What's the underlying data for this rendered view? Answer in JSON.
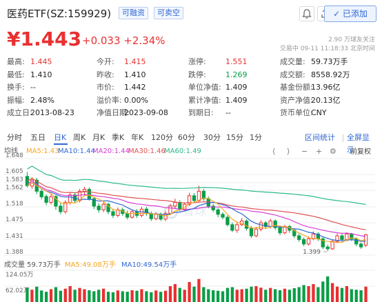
{
  "header": {
    "title": "医药ETF(SZ:159929)",
    "tags": [
      "可融资",
      "可卖空"
    ],
    "watch_label": "✓ 已添加"
  },
  "quote": {
    "price": "¥1.443",
    "change": "+0.033 +2.34%",
    "followers": "2.90 万球友关注",
    "status": "交易中 09-11 11:18:33 北京时间"
  },
  "stats": [
    [
      {
        "l": "最高:",
        "v": "1.445",
        "c": "red"
      },
      {
        "l": "今开:",
        "v": "1.415",
        "c": "red"
      },
      {
        "l": "涨停:",
        "v": "1.551",
        "c": "red"
      },
      {
        "l": "成交量:",
        "v": "59.73万手",
        "c": ""
      }
    ],
    [
      {
        "l": "最低:",
        "v": "1.410",
        "c": ""
      },
      {
        "l": "昨收:",
        "v": "1.410",
        "c": ""
      },
      {
        "l": "跌停:",
        "v": "1.269",
        "c": "green"
      },
      {
        "l": "成交额:",
        "v": "8558.92万",
        "c": ""
      }
    ],
    [
      {
        "l": "换手:",
        "v": "--",
        "c": ""
      },
      {
        "l": "市价:",
        "v": "1.442",
        "c": ""
      },
      {
        "l": "单位净值:",
        "v": "1.409",
        "c": ""
      },
      {
        "l": "基金份额:",
        "v": "13.96亿",
        "c": ""
      }
    ],
    [
      {
        "l": "振幅:",
        "v": "2.48%",
        "c": ""
      },
      {
        "l": "溢价率:",
        "v": "0.00%",
        "c": ""
      },
      {
        "l": "累计净值:",
        "v": "1.409",
        "c": ""
      },
      {
        "l": "资产净值:",
        "v": "20.13亿",
        "c": ""
      }
    ],
    [
      {
        "l": "成立日:",
        "v": "2013-08-23",
        "c": ""
      },
      {
        "l": "净值日期:",
        "v": "2023-09-08",
        "c": ""
      },
      {
        "l": "到期日:",
        "v": "--",
        "c": ""
      },
      {
        "l": "货币单位:",
        "v": "CNY",
        "c": ""
      }
    ]
  ],
  "tabs": [
    "分时",
    "五日",
    "日K",
    "周K",
    "月K",
    "季K",
    "年K",
    "120分",
    "60分",
    "30分",
    "15分",
    "1分"
  ],
  "active_tab": "日K",
  "tab_actions": [
    "区间统计",
    "全屏显示"
  ],
  "kline": {
    "legend": {
      "label": "均线",
      "ma5": "MA5:1.43",
      "ma10": "MA10:1.44",
      "ma20": "MA20:1.44",
      "ma30": "MA30:1.46",
      "ma60": "MA60:1.49"
    },
    "adjust": "前复权",
    "y_ticks": [
      "1.648",
      "1.605",
      "1.583",
      "1.562",
      "1.518",
      "1.475",
      "1.431",
      "1.388"
    ],
    "min_label": "1.399",
    "colors": {
      "up": "#e93030",
      "down": "#0a9e46",
      "ma5": "#f5a623",
      "ma10": "#2f66d4",
      "ma20": "#d63bd6",
      "ma30": "#e05050",
      "ma60": "#2bb98a"
    }
  },
  "volume": {
    "legend": {
      "vol": "成交量 59.73万手",
      "ma5": "MA5:49.08万手",
      "ma10": "MA10:49.54万手"
    },
    "y_ticks": [
      "124.05万",
      "62.02万"
    ]
  },
  "chart_data": {
    "type": "candlestick",
    "ylim": [
      1.388,
      1.648
    ],
    "candles": [
      [
        1.6,
        1.575,
        1.612,
        1.57
      ],
      [
        1.574,
        1.59,
        1.598,
        1.566
      ],
      [
        1.59,
        1.56,
        1.596,
        1.552
      ],
      [
        1.56,
        1.545,
        1.568,
        1.538
      ],
      [
        1.546,
        1.53,
        1.552,
        1.522
      ],
      [
        1.53,
        1.545,
        1.552,
        1.524
      ],
      [
        1.546,
        1.52,
        1.55,
        1.51
      ],
      [
        1.52,
        1.505,
        1.528,
        1.498
      ],
      [
        1.505,
        1.53,
        1.536,
        1.5
      ],
      [
        1.53,
        1.55,
        1.556,
        1.524
      ],
      [
        1.55,
        1.535,
        1.556,
        1.528
      ],
      [
        1.535,
        1.56,
        1.566,
        1.53
      ],
      [
        1.56,
        1.565,
        1.572,
        1.548
      ],
      [
        1.565,
        1.54,
        1.57,
        1.535
      ],
      [
        1.54,
        1.52,
        1.545,
        1.512
      ],
      [
        1.52,
        1.51,
        1.528,
        1.502
      ],
      [
        1.51,
        1.525,
        1.53,
        1.504
      ],
      [
        1.525,
        1.505,
        1.53,
        1.498
      ],
      [
        1.505,
        1.495,
        1.512,
        1.488
      ],
      [
        1.495,
        1.51,
        1.516,
        1.49
      ],
      [
        1.51,
        1.5,
        1.516,
        1.494
      ],
      [
        1.5,
        1.49,
        1.508,
        1.484
      ],
      [
        1.49,
        1.505,
        1.51,
        1.486
      ],
      [
        1.505,
        1.495,
        1.512,
        1.488
      ],
      [
        1.495,
        1.512,
        1.518,
        1.49
      ],
      [
        1.512,
        1.5,
        1.518,
        1.494
      ],
      [
        1.5,
        1.486,
        1.506,
        1.48
      ],
      [
        1.486,
        1.498,
        1.504,
        1.482
      ],
      [
        1.498,
        1.485,
        1.503,
        1.48
      ],
      [
        1.485,
        1.5,
        1.506,
        1.48
      ],
      [
        1.5,
        1.52,
        1.526,
        1.496
      ],
      [
        1.52,
        1.53,
        1.54,
        1.514
      ],
      [
        1.53,
        1.512,
        1.536,
        1.506
      ],
      [
        1.512,
        1.525,
        1.53,
        1.506
      ],
      [
        1.525,
        1.548,
        1.556,
        1.52
      ],
      [
        1.548,
        1.535,
        1.555,
        1.53
      ],
      [
        1.535,
        1.56,
        1.575,
        1.53
      ],
      [
        1.56,
        1.54,
        1.566,
        1.534
      ],
      [
        1.54,
        1.52,
        1.546,
        1.514
      ],
      [
        1.52,
        1.51,
        1.526,
        1.504
      ],
      [
        1.51,
        1.498,
        1.515,
        1.49
      ],
      [
        1.498,
        1.49,
        1.504,
        1.484
      ],
      [
        1.49,
        1.47,
        1.495,
        1.465
      ],
      [
        1.47,
        1.455,
        1.476,
        1.45
      ],
      [
        1.455,
        1.47,
        1.476,
        1.448
      ],
      [
        1.47,
        1.48,
        1.488,
        1.466
      ],
      [
        1.48,
        1.46,
        1.485,
        1.454
      ],
      [
        1.46,
        1.44,
        1.466,
        1.434
      ],
      [
        1.44,
        1.458,
        1.464,
        1.436
      ],
      [
        1.458,
        1.475,
        1.482,
        1.452
      ],
      [
        1.475,
        1.465,
        1.48,
        1.458
      ],
      [
        1.465,
        1.48,
        1.486,
        1.46
      ],
      [
        1.48,
        1.462,
        1.485,
        1.456
      ],
      [
        1.462,
        1.448,
        1.468,
        1.442
      ],
      [
        1.448,
        1.465,
        1.47,
        1.444
      ],
      [
        1.465,
        1.455,
        1.47,
        1.448
      ],
      [
        1.455,
        1.44,
        1.46,
        1.434
      ],
      [
        1.44,
        1.43,
        1.446,
        1.424
      ],
      [
        1.43,
        1.418,
        1.436,
        1.412
      ],
      [
        1.418,
        1.432,
        1.438,
        1.414
      ],
      [
        1.432,
        1.445,
        1.452,
        1.428
      ],
      [
        1.445,
        1.432,
        1.45,
        1.426
      ],
      [
        1.432,
        1.41,
        1.436,
        1.404
      ],
      [
        1.41,
        1.405,
        1.416,
        1.399
      ],
      [
        1.405,
        1.425,
        1.43,
        1.402
      ],
      [
        1.425,
        1.44,
        1.446,
        1.42
      ],
      [
        1.44,
        1.43,
        1.446,
        1.424
      ],
      [
        1.43,
        1.445,
        1.45,
        1.426
      ],
      [
        1.445,
        1.432,
        1.448,
        1.426
      ],
      [
        1.432,
        1.418,
        1.436,
        1.412
      ],
      [
        1.418,
        1.41,
        1.422,
        1.405
      ],
      [
        1.415,
        1.443,
        1.445,
        1.41
      ]
    ],
    "volumes": [
      55,
      48,
      60,
      45,
      40,
      50,
      58,
      44,
      52,
      62,
      48,
      55,
      50,
      46,
      42,
      48,
      52,
      40,
      38,
      45,
      42,
      40,
      46,
      44,
      50,
      42,
      38,
      45,
      40,
      44,
      62,
      70,
      55,
      48,
      78,
      60,
      90,
      58,
      50,
      46,
      44,
      42,
      55,
      58,
      48,
      50,
      52,
      60,
      62,
      56,
      48,
      55,
      50,
      46,
      52,
      48,
      54,
      58,
      66,
      62,
      70,
      58,
      80,
      100,
      74,
      60,
      55,
      62,
      50,
      48,
      46,
      60
    ]
  }
}
